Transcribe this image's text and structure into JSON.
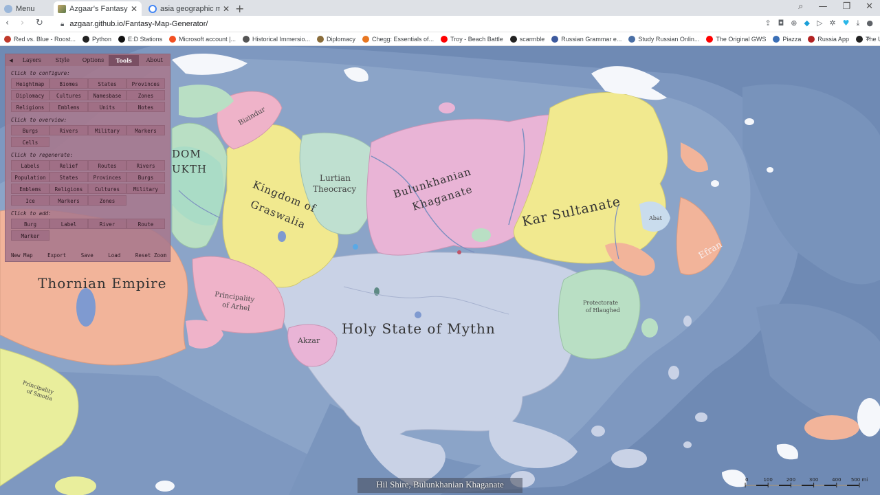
{
  "browser": {
    "menu_tab": "Menu",
    "tabs": [
      {
        "title": "Azgaar's Fantasy Map Gene",
        "active": true
      },
      {
        "title": "asia geographic map - Goo",
        "active": false
      }
    ],
    "url": "azgaar.github.io/Fantasy-Map-Generator/",
    "bookmarks": [
      {
        "label": "Red vs. Blue - Roost...",
        "color": "#c0392b"
      },
      {
        "label": "Python",
        "color": "#222222"
      },
      {
        "label": "E:D Stations",
        "color": "#111111"
      },
      {
        "label": "Microsoft account |...",
        "color": "#f25022"
      },
      {
        "label": "Historical Immersio...",
        "color": "#555555"
      },
      {
        "label": "Diplomacy",
        "color": "#8a6d3b"
      },
      {
        "label": "Chegg: Essentials of...",
        "color": "#e87722"
      },
      {
        "label": "Troy - Beach Battle",
        "color": "#ff0000"
      },
      {
        "label": "scarmble",
        "color": "#222222"
      },
      {
        "label": "Russian Grammar e...",
        "color": "#3d5a9e"
      },
      {
        "label": "Study Russian Onlin...",
        "color": "#4a6fa5"
      },
      {
        "label": "The Original GWS",
        "color": "#ff0000"
      },
      {
        "label": "Piazza",
        "color": "#3b6fb6"
      },
      {
        "label": "Russia App",
        "color": "#b22222"
      },
      {
        "label": "The Ultimate Catch...",
        "color": "#222222"
      }
    ]
  },
  "panel": {
    "tabs": [
      "Layers",
      "Style",
      "Options",
      "Tools",
      "About"
    ],
    "active_tab": "Tools",
    "configure_heading": "Click to configure:",
    "configure": [
      "Heightmap",
      "Biomes",
      "States",
      "Provinces",
      "Diplomacy",
      "Cultures",
      "Namesbase",
      "Zones",
      "Religions",
      "Emblems",
      "Units",
      "Notes"
    ],
    "overview_heading": "Click to overview:",
    "overview": [
      "Burgs",
      "Rivers",
      "Military",
      "Markers",
      "Cells"
    ],
    "regenerate_heading": "Click to regenerate:",
    "regenerate": [
      "Labels",
      "Relief",
      "Routes",
      "Rivers",
      "Population",
      "States",
      "Provinces",
      "Burgs",
      "Emblems",
      "Religions",
      "Cultures",
      "Military",
      "Ice",
      "Markers",
      "Zones"
    ],
    "add_heading": "Click to add:",
    "add": [
      "Burg",
      "Label",
      "River",
      "Route",
      "Marker"
    ],
    "footer": [
      "New Map",
      "Export",
      "Save",
      "Load",
      "Reset Zoom"
    ]
  },
  "map": {
    "state_labels": {
      "thornian": "Thornian Empire",
      "kingdom_g": "Kingdom of",
      "kingdom_g2": "Graswalia",
      "lurtian": "Lurtian",
      "lurtian2": "Theocracy",
      "bulunkhanian": "Bulunkhanian",
      "bulunkhanian2": "Khaganate",
      "kar": "Kar Sultanate",
      "mythn": "Holy State of Mythn",
      "arhel": "Principality",
      "arhel2": "of Arhel",
      "akzar": "Akzar",
      "bizindur": "Bizindur",
      "efran": "Efran",
      "abat": "Abat",
      "protectorate": "Protectorate",
      "protectorate2": "of Hlaughed",
      "smotia": "Principality",
      "smotia2": "of Smotia",
      "dom": "DOM",
      "ukth": "UKTH"
    },
    "colors": {
      "ocean": "#6f8ab4",
      "shelf": "#8aa4c8",
      "pink": "#e9b4d6",
      "yellow": "#f1e98f",
      "green": "#b9dfc4",
      "salmon": "#f2b49a",
      "lavender": "#c9d2e6",
      "rose": "#efb3c9",
      "teal": "#a9dcc7"
    }
  },
  "caption": "Hil Shire, Bulunkhanian Khaganate",
  "scale": {
    "ticks": [
      "0",
      "100",
      "200",
      "300",
      "400",
      "500 mi"
    ]
  }
}
